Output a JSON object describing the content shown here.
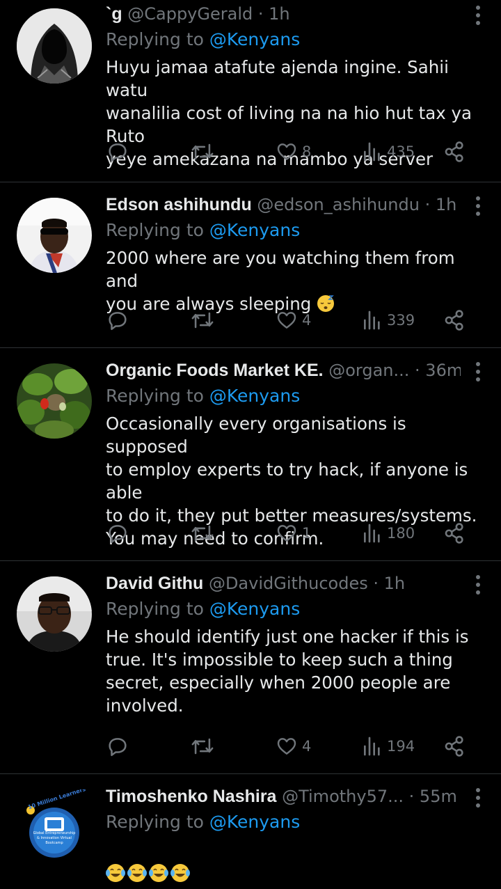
{
  "tweets": [
    {
      "name": "`g",
      "handle": "@CappyGerald",
      "time": "1h",
      "replying_prefix": "Replying to ",
      "replying_to": "@Kenyans",
      "text": "Huyu jamaa atafute ajenda ingine. Sahii watu\nwanalilia cost of living na na hio hut tax ya Ruto\nyeye amekazana na mambo ya server",
      "likes": "8",
      "views": "435",
      "avatar": "hooded-figure-avatar"
    },
    {
      "name": "Edson ashihundu",
      "handle": "@edson_ashihundu",
      "time": "1h",
      "replying_prefix": "Replying to ",
      "replying_to": "@Kenyans",
      "text": "2000 where are you watching them from and\nyou are always sleeping",
      "emoji": "sleeping-face-emoji",
      "likes": "4",
      "views": "339",
      "avatar": "man-sunglasses-avatar"
    },
    {
      "name": "Organic Foods Market KE.",
      "handle": "@organ...",
      "time": "36m",
      "replying_prefix": "Replying to ",
      "replying_to": "@Kenyans",
      "text": "Occasionally every organisations is supposed\nto employ experts to try hack, if anyone is able\nto do it, they put better measures/systems.\nYou may need to confirm.",
      "likes": "1",
      "views": "180",
      "avatar": "strawberry-plant-avatar"
    },
    {
      "name": "David Githu",
      "handle": "@DavidGithucodes",
      "time": "1h",
      "replying_prefix": "Replying to ",
      "replying_to": "@Kenyans",
      "text": "He should identify just one hacker if this is\ntrue. It's impossible to keep such a thing\nsecret, especially when 2000 people are\ninvolved.",
      "likes": "4",
      "views": "194",
      "avatar": "man-glasses-avatar"
    },
    {
      "name": "Timoshenko Nashira",
      "handle": "@Timothy57...",
      "time": "55m",
      "replying_prefix": "Replying to ",
      "replying_to": "@Kenyans",
      "emoji": "laughing-tears-emoji",
      "avatar": "million-learners-logo-avatar",
      "logo_text_top": "10 Million Learners",
      "logo_text_bottom": "Global Entrepreneurship & Innovation Virtual Bootcamp"
    }
  ],
  "colors": {
    "background": "#000000",
    "text": "#e7e9ea",
    "muted": "#71767b",
    "link": "#1d9bf0",
    "divider": "#2f3336"
  }
}
